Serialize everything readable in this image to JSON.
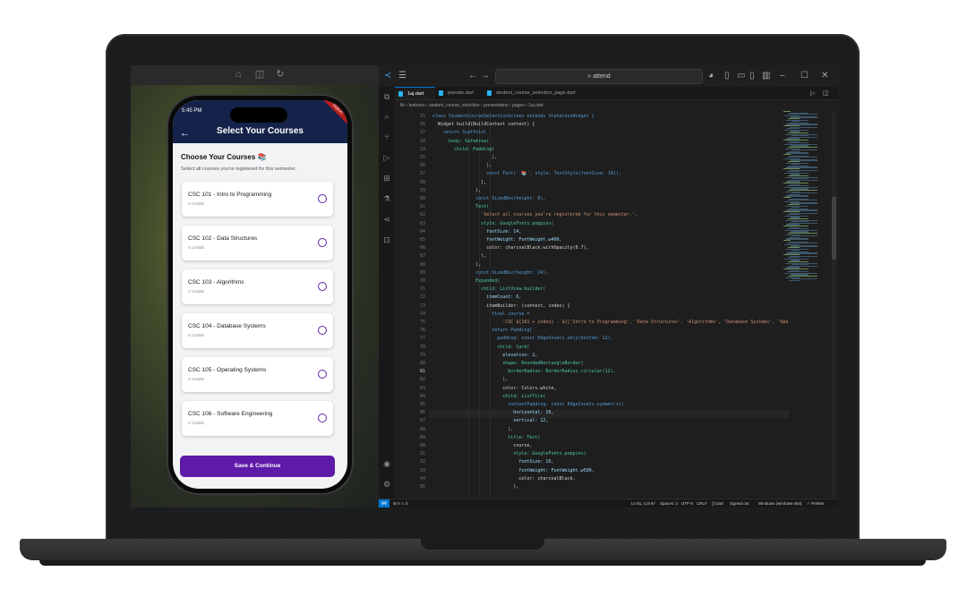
{
  "phone_app": {
    "status_time": "5:45 PM",
    "title": "Select Your Courses",
    "heading": "Choose Your Courses 📚",
    "subheading": "Select all courses you're registered for this semester.",
    "courses": [
      {
        "title": "CSC 101 - Intro to Programming",
        "credits": "3 Credits"
      },
      {
        "title": "CSC 102 - Data Structures",
        "credits": "4 Credits"
      },
      {
        "title": "CSC 103 - Algorithms",
        "credits": "3 Credits"
      },
      {
        "title": "CSC 104 - Database Systems",
        "credits": "4 Credits"
      },
      {
        "title": "CSC 105 - Operating Systems",
        "credits": "3 Credits"
      },
      {
        "title": "CSC 106 - Software Engineering",
        "credits": "4 Credits"
      }
    ],
    "save_label": "Save & Continue",
    "colors": {
      "header": "#15234a",
      "accent": "#5e1aa8"
    }
  },
  "vscode": {
    "search_text": "attend",
    "tabs": [
      {
        "label": "1aj.dart",
        "active": true
      },
      {
        "label": "pseudo.dart",
        "active": false
      },
      {
        "label": "student_course_selection_page.dart",
        "active": false
      }
    ],
    "breadcrumb": "lib › features › student_course_selection › presentation › pages › 1aj.dart",
    "line_numbers": [
      "15",
      "16",
      "17",
      "18",
      "19",
      "55",
      "56",
      "57",
      "58",
      "59",
      "60",
      "61",
      "62",
      "63",
      "64",
      "65",
      "66",
      "67",
      "68",
      "69",
      "70",
      "71",
      "72",
      "73",
      "74",
      "75",
      "76",
      "77",
      "78",
      "79",
      "80",
      "81",
      "82",
      "83",
      "84",
      "85",
      "86",
      "87",
      "88",
      "89",
      "90",
      "91",
      "92",
      "93",
      "94",
      "95"
    ],
    "code": [
      "class StudentCourseSelectionScreen extends StatelessWidget {",
      "  Widget build(BuildContext context) {",
      "    return Scaffold(",
      "      body: SafeArea(",
      "        child: Padding(",
      "                      ),",
      "                    ),",
      "                    const Text(' 📚', style: TextStyle(fontSize: 18)),",
      "                  ],",
      "                ),",
      "                const SizedBox(height: 8),",
      "                Text(",
      "                  'Select all courses you're registered for this semester.',",
      "                  style: GoogleFonts.poppins(",
      "                    fontSize: 14,",
      "                    fontWeight: FontWeight.w400,",
      "                    color: charcoalBlack.withOpacity(0.7),",
      "                  ),",
      "                ),",
      "                const SizedBox(height: 24),",
      "                Expanded(",
      "                  child: ListView.builder(",
      "                    itemCount: 6,",
      "                    itemBuilder: (context, index) {",
      "                      final course =",
      "                          'CSC ${101 + index} - ${['Intro to Programming', 'Data Structures', 'Algorithms', 'Database Systems', 'Operating Systems',",
      "                      return Padding(",
      "                        padding: const EdgeInsets.only(bottom: 12),",
      "                        child: Card(",
      "                          elevation: 2,",
      "                          shape: RoundedRectangleBorder(",
      "                            borderRadius: BorderRadius.circular(12),",
      "                          ),",
      "                          color: Colors.white,",
      "                          child: ListTile(",
      "                            contentPadding: const EdgeInsets.symmetric(",
      "                              horizontal: 16,",
      "                              vertical: 12,",
      "                            ),",
      "                            title: Text(",
      "                              course,",
      "                              style: GoogleFonts.poppins(",
      "                                fontSize: 16,",
      "                                fontWeight: FontWeight.w500,",
      "                                color: charcoalBlack,",
      "                              ),"
    ],
    "status": {
      "errors": "⊗ 0 ⚠ 0",
      "position": "Ln 81, Col 67",
      "spaces": "Spaces: 2",
      "encoding": "UTF-8",
      "eol": "CRLF",
      "language": "{} Dart",
      "signed": "Signed out",
      "device": "Windows (windows-x64)",
      "prettier": "✓ Prettier"
    }
  }
}
